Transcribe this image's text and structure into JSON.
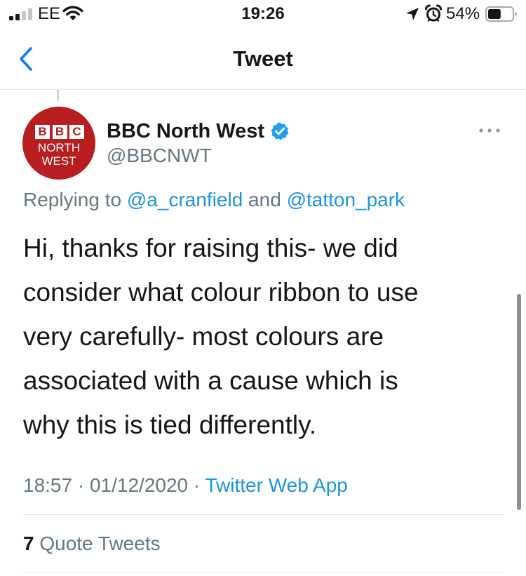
{
  "status_bar": {
    "carrier": "EE",
    "time": "19:26",
    "battery_percent": "54%",
    "battery_level": 0.54,
    "signal_bars_filled": 2,
    "signal_bars_total": 4,
    "icons": [
      "signal-icon",
      "wifi-icon",
      "location-arrow-icon",
      "alarm-clock-icon",
      "battery-icon"
    ]
  },
  "nav": {
    "title": "Tweet",
    "back_icon": "chevron-left-icon"
  },
  "tweet": {
    "author": {
      "display_name": "BBC North West",
      "handle": "@BBCNWT",
      "verified": true,
      "avatar": {
        "letters": [
          "B",
          "B",
          "C"
        ],
        "line1": "NORTH",
        "line2": "WEST",
        "background": "#b81e1f"
      }
    },
    "replying": {
      "prefix": "Replying to ",
      "mention1": "@a_cranfield",
      "joiner": " and ",
      "mention2": "@tatton_park"
    },
    "text_lines": [
      "Hi, thanks for raising this- we did",
      "consider what colour ribbon to use",
      "very carefully- most colours are",
      "associated with a cause which is",
      "why this is tied differently."
    ],
    "meta": {
      "time": "18:57",
      "separator": " · ",
      "date": "01/12/2020",
      "source": "Twitter Web App"
    },
    "stats": {
      "count": "7",
      "label": " Quote Tweets"
    }
  },
  "colors": {
    "accent": "#1b95e0",
    "ios_blue": "#0a7aff",
    "text_primary": "#14171a",
    "text_secondary": "#657786",
    "divider": "#e1e8ed",
    "verified": "#1da1f2"
  }
}
